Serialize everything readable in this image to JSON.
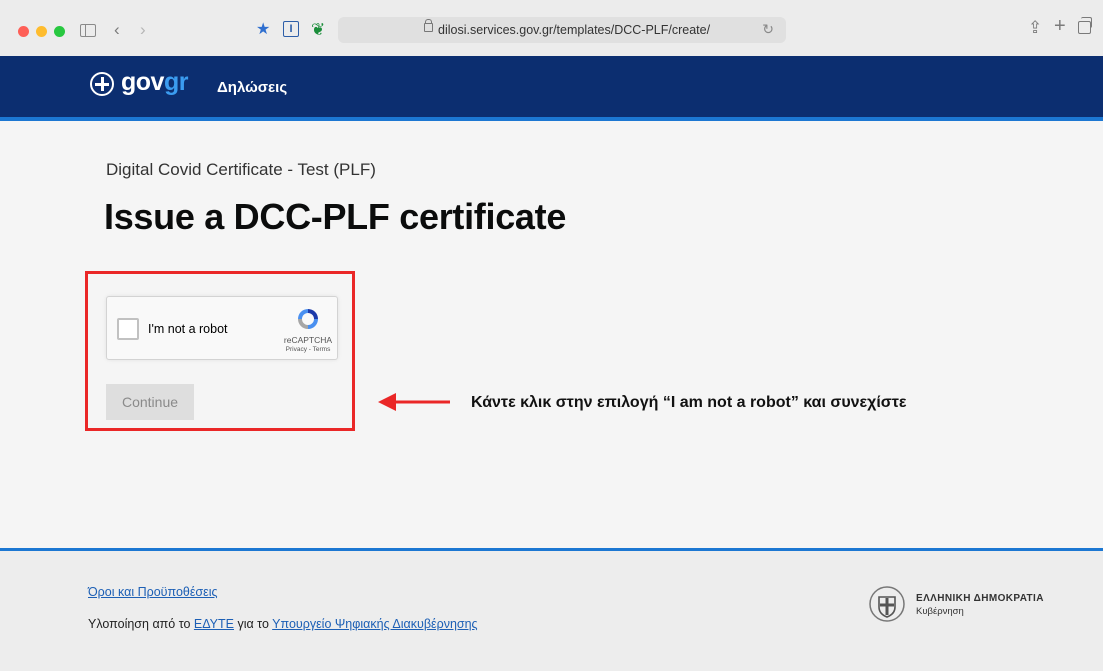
{
  "browser": {
    "url": "dilosi.services.gov.gr/templates/DCC-PLF/create/"
  },
  "header": {
    "logo_gov": "gov",
    "logo_gr": "gr",
    "nav_title": "Δηλώσεις"
  },
  "main": {
    "eyebrow": "Digital Covid Certificate - Test (PLF)",
    "title": "Issue a DCC-PLF certificate",
    "recaptcha": {
      "label": "I'm not a robot",
      "brand": "reCAPTCHA",
      "links": "Privacy - Terms",
      "checked": false
    },
    "continue_label": "Continue",
    "callout": "Κάντε κλικ στην επιλογή “I am not a robot” και συνεχίστε"
  },
  "footer": {
    "terms_link": "Όροι και Προϋποθέσεις",
    "credit_prefix": "Υλοποίηση από το ",
    "credit_org1": "ΕΔΥΤΕ",
    "credit_middle": " για το ",
    "credit_org2": "Υπουργείο Ψηφιακής Διακυβέρνησης",
    "republic_name": "ΕΛΛΗΝΙΚΗ ΔΗΜΟΚΡΑΤΙΑ",
    "republic_sub": "Κυβέρνηση"
  },
  "colors": {
    "header_bg": "#0c2e70",
    "accent": "#1c77d2",
    "highlight": "#ea2727",
    "link": "#1c5fb5"
  }
}
